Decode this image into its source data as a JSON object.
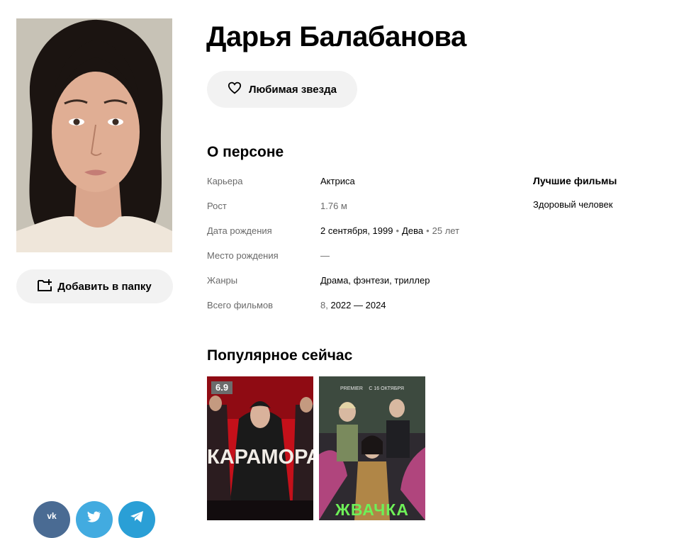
{
  "person": {
    "name": "Дарья Балабанова",
    "favorite_label": "Любимая звезда",
    "add_folder_label": "Добавить в папку"
  },
  "about": {
    "title": "О персоне",
    "rows": [
      {
        "label": "Карьера",
        "value": "Актриса"
      },
      {
        "label": "Рост",
        "value": "1.76 м"
      },
      {
        "label": "Дата рождения",
        "date": "2 сентября, 1999",
        "zodiac": "Дева",
        "age": "25 лет"
      },
      {
        "label": "Место рождения",
        "value": "—"
      },
      {
        "label": "Жанры",
        "value": "Драма, фэнтези, триллер"
      },
      {
        "label": "Всего фильмов",
        "count": "8,",
        "years": "2022 — 2024"
      }
    ]
  },
  "best_films": {
    "title": "Лучшие фильмы",
    "items": [
      "Здоровый человек"
    ]
  },
  "popular": {
    "title": "Популярное сейчас",
    "items": [
      {
        "rating": "6.9",
        "poster_text": "КАРАМОРА"
      },
      {
        "poster_brand": "PREMIER",
        "poster_date": "С 16 ОКТЯБРЯ",
        "poster_text": "ЖВАЧКА"
      }
    ]
  },
  "social": {
    "vk_label": "vk",
    "icons": [
      "vk-icon",
      "twitter-icon",
      "telegram-icon"
    ]
  },
  "colors": {
    "button_bg": "#f2f2f2",
    "rating_bg": "#6c6c6c",
    "vk": "#4a6b93",
    "twitter": "#42abe0",
    "telegram": "#2a9fd6"
  }
}
